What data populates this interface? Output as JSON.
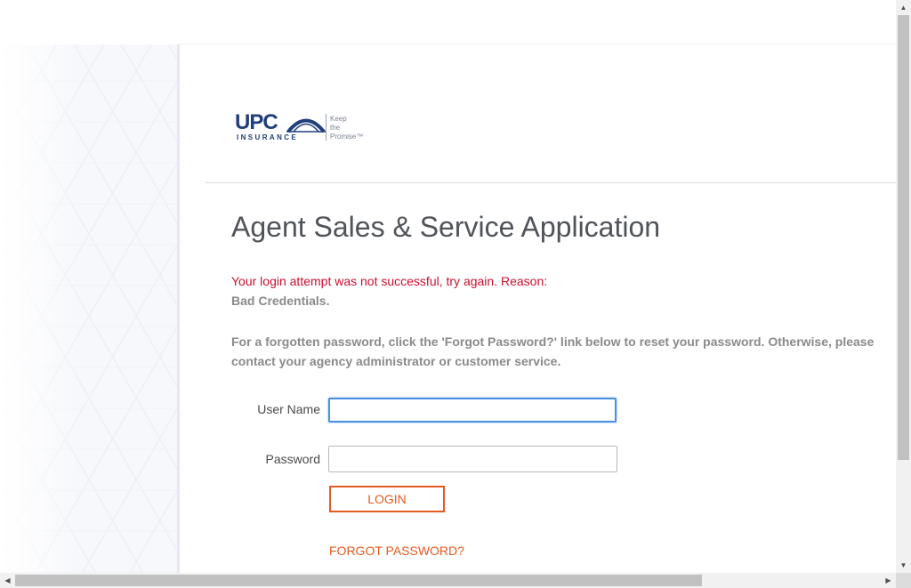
{
  "logo": {
    "brand": "UPC",
    "sub": "INSURANCE",
    "tagline_1": "Keep",
    "tagline_2": "the",
    "tagline_3": "Promise™"
  },
  "page": {
    "title": "Agent Sales & Service Application"
  },
  "error": {
    "line1": "Your login attempt was not successful, try again. Reason:",
    "line2": "Bad Credentials."
  },
  "info": {
    "text": "For a forgotten password, click the 'Forgot Password?' link below to reset your password. Otherwise, please contact your agency administrator or customer service."
  },
  "form": {
    "username_label": "User Name",
    "username_value": "",
    "password_label": "Password",
    "password_value": "",
    "login_label": "LOGIN",
    "forgot_label": "FORGOT PASSWORD?"
  },
  "scrollbars": {
    "up": "▲",
    "down": "▼",
    "left": "◀",
    "right": "▶"
  },
  "colors": {
    "accent": "#e55a1f",
    "error": "#c8102e",
    "brand_blue": "#1f3f7a",
    "focus": "#4a90e2"
  }
}
